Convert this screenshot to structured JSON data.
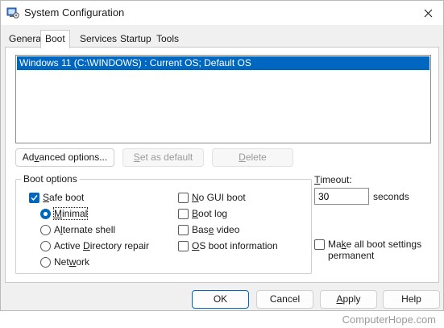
{
  "window": {
    "title": "System Configuration"
  },
  "tabs": [
    {
      "label": "General"
    },
    {
      "label": "Boot"
    },
    {
      "label": "Services"
    },
    {
      "label": "Startup"
    },
    {
      "label": "Tools"
    }
  ],
  "os_list": {
    "selected_item": "Windows 11 (C:\\WINDOWS) : Current OS; Default OS"
  },
  "list_buttons": {
    "advanced_prefix": "Ad",
    "advanced_u": "v",
    "advanced_rest": "anced options...",
    "set_default_u": "S",
    "set_default_rest": "et as default",
    "delete_u": "D",
    "delete_rest": "elete"
  },
  "boot_options": {
    "label": "Boot options",
    "safe_boot_u": "S",
    "safe_boot_rest": "afe boot",
    "minimal_u": "M",
    "minimal_rest": "inimal",
    "alternate_shell_prefix": "A",
    "alternate_shell_u": "l",
    "alternate_shell_rest": "ternate shell",
    "ad_repair_prefix": "Active ",
    "ad_repair_u": "D",
    "ad_repair_rest": "irectory repair",
    "network_prefix": "Net",
    "network_u": "w",
    "network_rest": "ork",
    "no_gui_u": "N",
    "no_gui_rest": "o GUI boot",
    "boot_log_u": "B",
    "boot_log_rest": "oot log",
    "base_video_prefix": "Bas",
    "base_video_u": "e",
    "base_video_rest": " video",
    "os_info_u": "O",
    "os_info_rest": "S boot information"
  },
  "timeout": {
    "label_u": "T",
    "label_rest": "imeout:",
    "value": "30",
    "unit": "seconds"
  },
  "make_permanent": {
    "line1_prefix": "Ma",
    "line1_u": "k",
    "line1_rest": "e all boot settings",
    "line2": "permanent"
  },
  "footer": {
    "ok": "OK",
    "cancel": "Cancel",
    "apply_u": "A",
    "apply_rest": "pply",
    "help": "Help"
  },
  "watermark": "ComputerHope.com",
  "colors": {
    "accent": "#0067c0"
  }
}
